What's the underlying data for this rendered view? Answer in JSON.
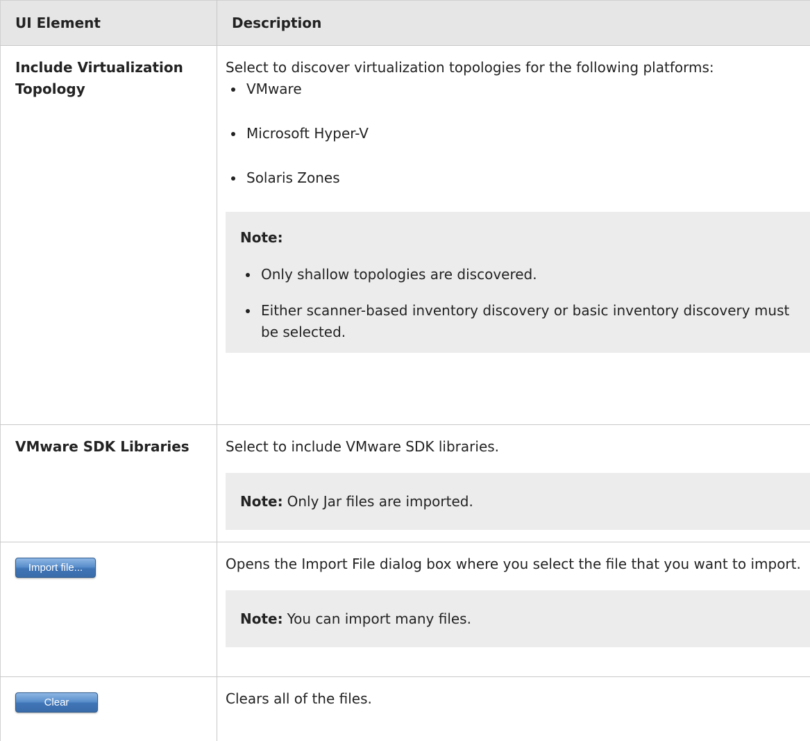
{
  "table": {
    "headers": [
      "UI Element",
      "Description"
    ],
    "rows": [
      {
        "element": "Include Virtualization Topology",
        "description": "Select to discover virtualization topologies for the following platforms:",
        "bullets": [
          "VMware",
          "Microsoft Hyper-V",
          "Solaris Zones"
        ],
        "note_label": "Note:",
        "note_bullets": [
          "Only shallow topologies are discovered.",
          "Either scanner-based inventory discovery or basic inventory discovery must be selected."
        ]
      },
      {
        "element": "VMware SDK Libraries",
        "description": "Select to include VMware SDK libraries.",
        "note_label": "Note:",
        "note_text": "Only Jar files are imported."
      },
      {
        "button_label": "Import file...",
        "description": "Opens the Import File dialog box where you select the file that you want to import.",
        "note_label": "Note:",
        "note_text": "You can import many files."
      },
      {
        "button_label": "Clear",
        "description": "Clears all of the files."
      }
    ]
  }
}
